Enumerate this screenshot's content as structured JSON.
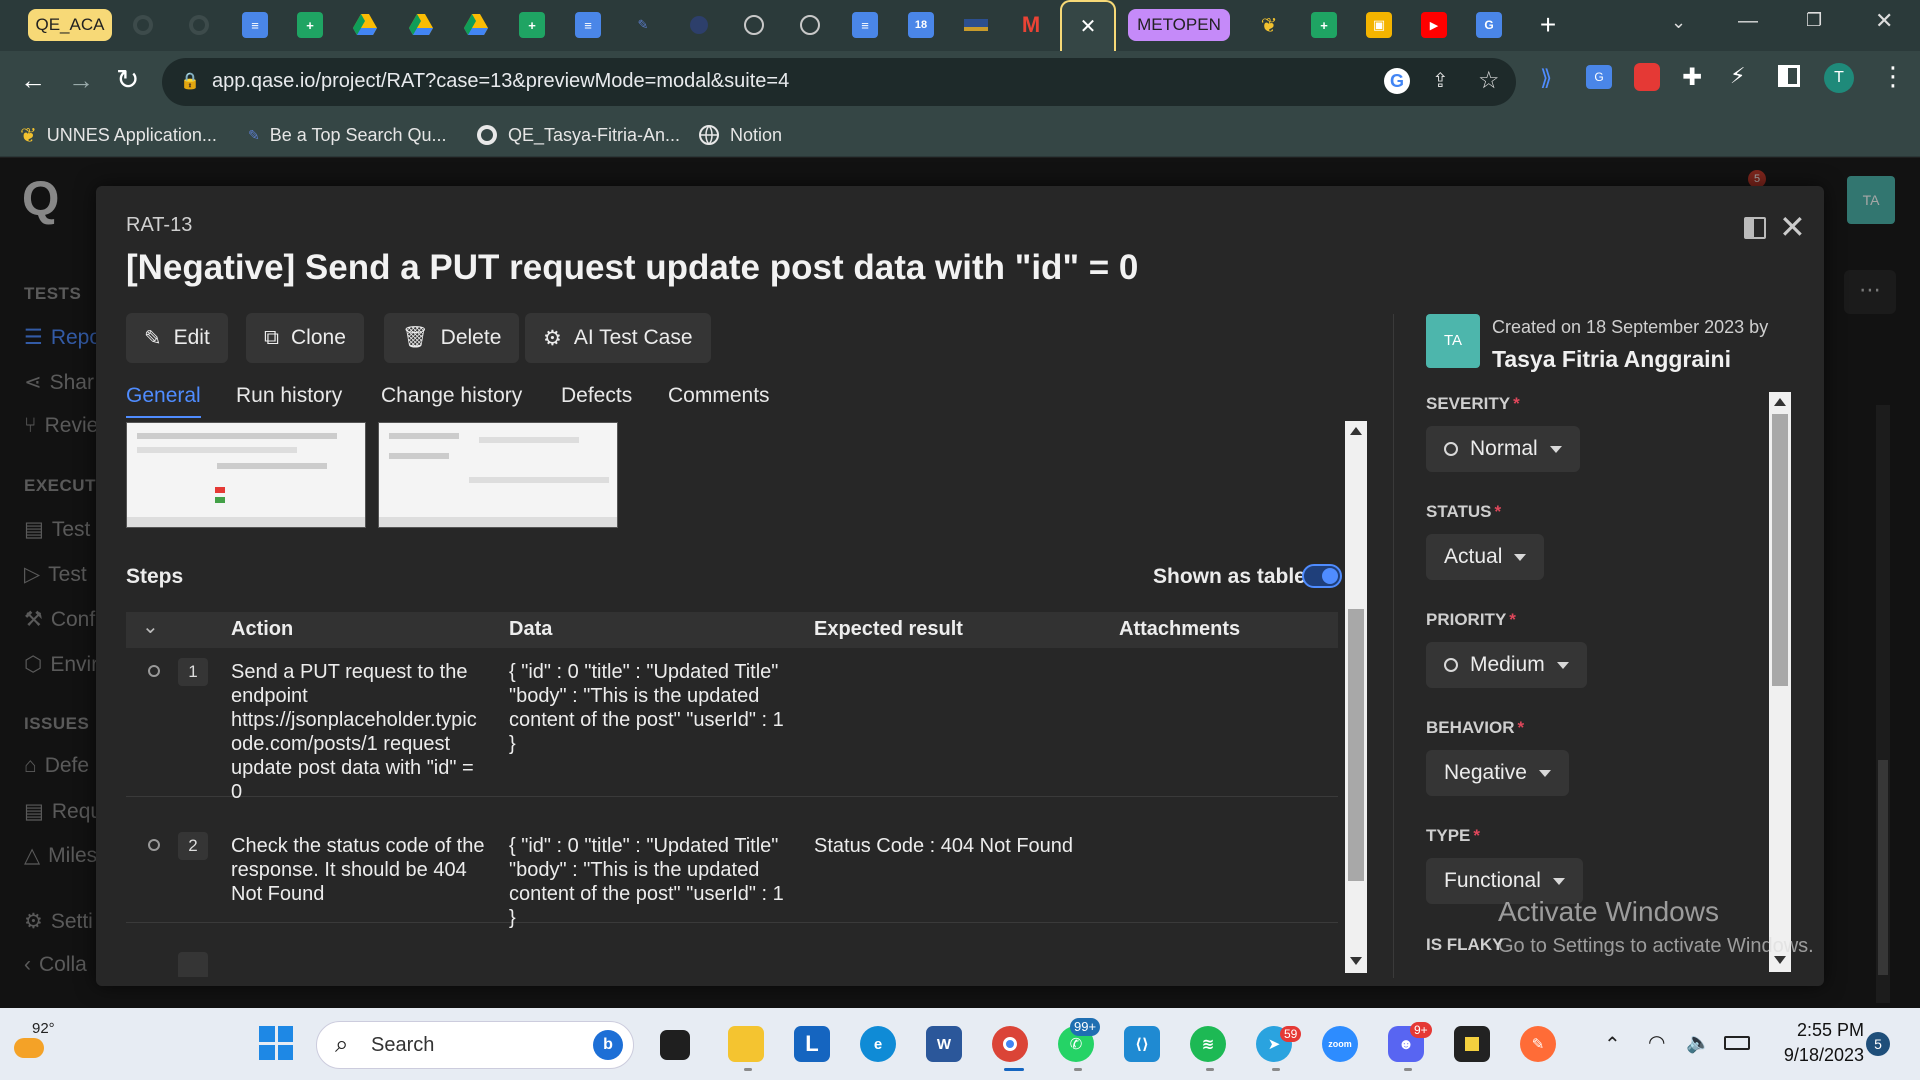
{
  "browser": {
    "tab_group_1": "QE_ACA",
    "tab_group_2": "METOPEN",
    "url": "app.qase.io/project/RAT?case=13&previewMode=modal&suite=4",
    "profile_initial": "T",
    "bookmarks": [
      {
        "label": "UNNES Application..."
      },
      {
        "label": "Be a Top Search Qu..."
      },
      {
        "label": "QE_Tasya-Fitria-An..."
      },
      {
        "label": "Notion"
      }
    ]
  },
  "sidebar": {
    "logo": "Q",
    "tests_header": "TESTS",
    "items_tests": [
      "Repo",
      "Shar",
      "Revie"
    ],
    "execution_header": "EXECUTI",
    "items_execution": [
      "Test",
      "Test",
      "Conf",
      "Envir"
    ],
    "issues_header": "ISSUES",
    "items_issues": [
      "Defe",
      "Requ",
      "Miles"
    ],
    "settings": "Setti",
    "collapse": "Colla",
    "notification_count": "5",
    "avatar": "TA"
  },
  "modal": {
    "case_id": "RAT-13",
    "title": "[Negative] Send a PUT request update post data with \"id\" = 0",
    "actions": {
      "edit": "Edit",
      "clone": "Clone",
      "delete": "Delete",
      "ai": "AI Test Case"
    },
    "tabs": [
      "General",
      "Run history",
      "Change history",
      "Defects",
      "Comments"
    ],
    "steps_label": "Steps",
    "shown_as_table": "Shown as table",
    "columns": [
      "Action",
      "Data",
      "Expected result",
      "Attachments"
    ],
    "steps": [
      {
        "num": "1",
        "action": "Send a PUT request to the endpoint https://jsonplaceholder.typicode.com/posts/1 request update post data with \"id\" = 0",
        "data": "{ \"id\" : 0 \"title\" : \"Updated Title\" \"body\" : \"This is the updated content of the post\" \"userId\" : 1 }",
        "expected": ""
      },
      {
        "num": "2",
        "action": "Check the status code of the response. It should be 404 Not Found",
        "data": "{ \"id\" : 0 \"title\" : \"Updated Title\" \"body\" : \"This is the updated content of the post\" \"userId\" : 1 }",
        "expected": "Status Code : 404 Not Found"
      }
    ],
    "meta": {
      "avatar": "TA",
      "created_on": "Created on 18 September 2023 by",
      "author": "Tasya Fitria Anggraini"
    },
    "fields": {
      "severity_label": "SEVERITY",
      "severity": "Normal",
      "status_label": "STATUS",
      "status": "Actual",
      "priority_label": "PRIORITY",
      "priority": "Medium",
      "behavior_label": "BEHAVIOR",
      "behavior": "Negative",
      "type_label": "TYPE",
      "type": "Functional",
      "flaky_label": "IS FLAKY"
    }
  },
  "watermark": {
    "line1": "Activate Windows",
    "line2": "Go to Settings to activate Windows."
  },
  "taskbar": {
    "weather": "92°",
    "search": "Search",
    "whatsapp_badge": "99+",
    "telegram_badge": "59",
    "discord_badge": "9+",
    "zoom_label": "zoom",
    "time": "2:55 PM",
    "date": "9/18/2023",
    "notif": "5"
  },
  "colors": {
    "accent": "#4f8cff",
    "avatar_bg": "#4db6ac",
    "required": "#e0475b"
  }
}
